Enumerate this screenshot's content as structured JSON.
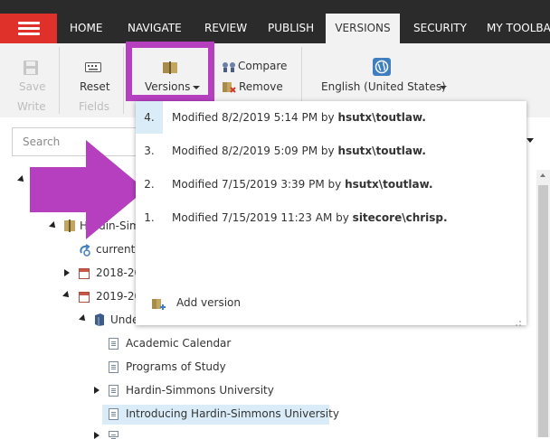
{
  "nav": {
    "tabs": [
      {
        "label": "HOME"
      },
      {
        "label": "NAVIGATE"
      },
      {
        "label": "REVIEW"
      },
      {
        "label": "PUBLISH"
      },
      {
        "label": "VERSIONS",
        "active": true
      },
      {
        "label": "SECURITY"
      },
      {
        "label": "MY TOOLBAR"
      }
    ]
  },
  "ribbon": {
    "save": {
      "label": "Save"
    },
    "write": {
      "label": "Write"
    },
    "reset": {
      "label": "Reset"
    },
    "fields": {
      "label": "Fields"
    },
    "versions": {
      "label": "Versions"
    },
    "compare": {
      "label": "Compare"
    },
    "remove": {
      "label": "Remove"
    },
    "language": {
      "label": "English (United States)"
    }
  },
  "search": {
    "placeholder": "Search"
  },
  "versions_menu": {
    "items": [
      {
        "num": "4.",
        "text": "Modified 8/2/2019 5:14 PM by ",
        "user": "hsutx\\toutlaw."
      },
      {
        "num": "3.",
        "text": "Modified 8/2/2019 5:09 PM by ",
        "user": "hsutx\\toutlaw."
      },
      {
        "num": "2.",
        "text": "Modified 7/15/2019 3:39 PM by ",
        "user": "hsutx\\toutlaw."
      },
      {
        "num": "1.",
        "text": "Modified 7/15/2019 11:23 AM by ",
        "user": "sitecore\\chrisp."
      }
    ],
    "add_version": "Add version"
  },
  "tree": {
    "items": [
      {
        "label": "Hardin-Simm"
      },
      {
        "label": "current"
      },
      {
        "label": "2018-20"
      },
      {
        "label": "2019-20"
      },
      {
        "label": "Unde"
      },
      {
        "label": "Academic Calendar"
      },
      {
        "label": "Programs of Study"
      },
      {
        "label": "Hardin-Simmons University"
      },
      {
        "label": "Introducing Hardin-Simmons University"
      }
    ]
  },
  "colors": {
    "accent_red": "#e0302a",
    "highlight_purple": "#b53fbf",
    "selection_blue": "#d9ecf7"
  }
}
